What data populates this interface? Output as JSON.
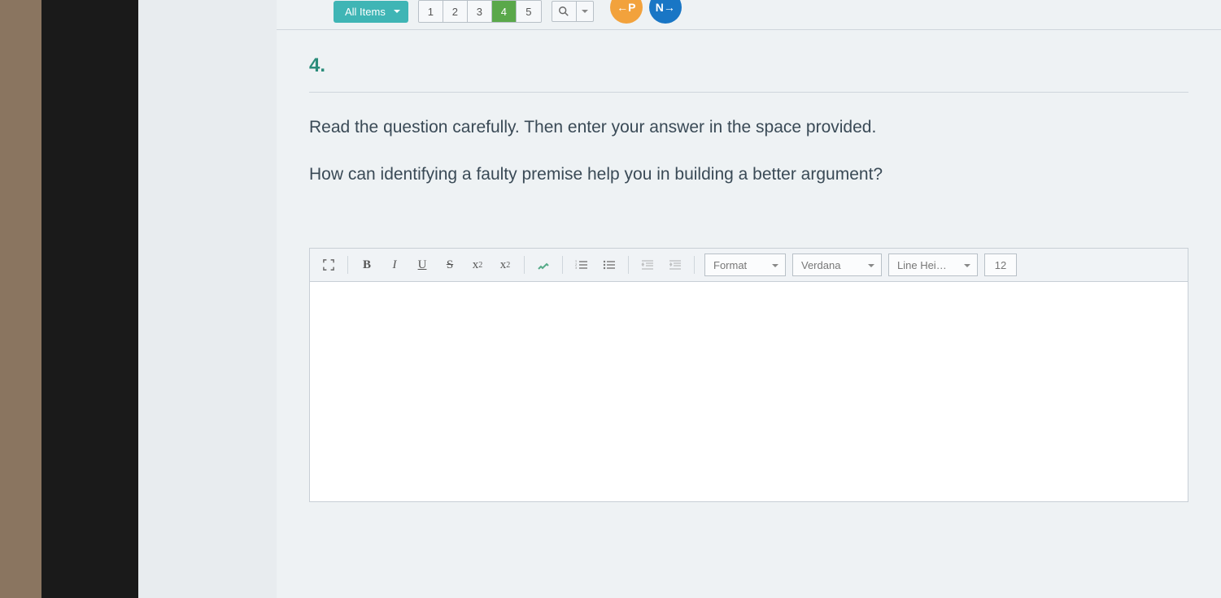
{
  "topbar": {
    "all_items_label": "All Items",
    "pages": [
      "1",
      "2",
      "3",
      "4",
      "5"
    ],
    "active_page_index": 3,
    "prev_label": "←P",
    "next_label": "N→"
  },
  "question": {
    "number_label": "4.",
    "instruction": "Read the question carefully. Then enter your answer in the space provided.",
    "prompt": "How can identifying a faulty premise help you in building a better argument?"
  },
  "editor": {
    "toolbar": {
      "bold": "B",
      "italic": "I",
      "underline": "U",
      "strike": "S",
      "subscript": "x",
      "sub_suffix": "2",
      "superscript": "x",
      "sup_suffix": "2",
      "format_label": "Format",
      "font_label": "Verdana",
      "lineheight_label": "Line Hei…",
      "fontsize_label": "12"
    },
    "content": ""
  }
}
